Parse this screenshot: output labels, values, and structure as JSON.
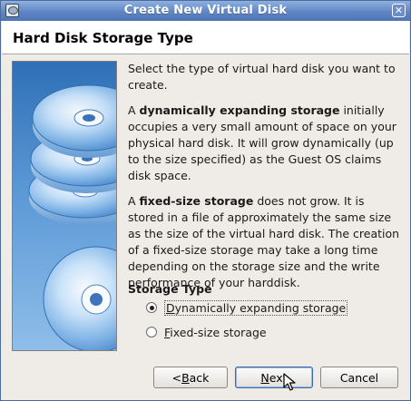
{
  "window": {
    "title": "Create New Virtual Disk"
  },
  "page": {
    "title": "Hard Disk Storage Type"
  },
  "intro": "Select the type of virtual hard disk you want to create.",
  "dynamic_paragraph": {
    "lead": "A ",
    "bold": "dynamically expanding storage",
    "rest": " initially occupies a very small amount of space on your physical hard disk. It will grow dynamically (up to the size specified) as the Guest OS claims disk space."
  },
  "fixed_paragraph": {
    "lead": "A ",
    "bold": "fixed-size storage",
    "rest": " does not grow. It is stored in a file of approximately the same size as the size of the virtual hard disk. The creation of a fixed-size storage may take a long time depending on the storage size and the write performance of your harddisk."
  },
  "storage_type": {
    "label": "Storage Type",
    "options": [
      {
        "mnemonic": "D",
        "label_rest": "ynamically expanding storage",
        "selected": true
      },
      {
        "mnemonic": "F",
        "label_rest": "ixed-size storage",
        "selected": false
      }
    ]
  },
  "buttons": {
    "back": {
      "prefix": "< ",
      "mnemonic": "B",
      "rest": "ack"
    },
    "next": {
      "mnemonic": "N",
      "rest": "ext"
    },
    "cancel": {
      "label": "Cancel"
    }
  },
  "icons": {
    "close": "close-icon",
    "app": "virtualbox-app-icon",
    "art": "disk-stack-illustration"
  },
  "colors": {
    "titlebar": "#5f86c4",
    "art_blue": "#2f6fb5",
    "default_button_border": "#3c6aa8"
  }
}
